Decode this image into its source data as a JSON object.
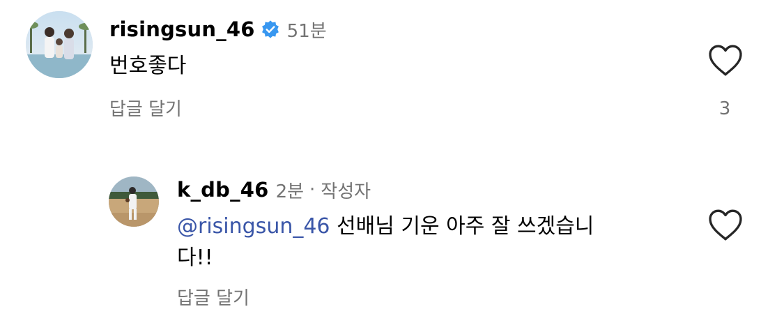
{
  "comments": [
    {
      "username": "risingsun_46",
      "verified": true,
      "time": "51분",
      "text": "번호좋다",
      "reply_label": "답글 달기",
      "like_count": "3"
    },
    {
      "username": "k_db_46",
      "verified": false,
      "time": "2분",
      "separator": "·",
      "author_badge": "작성자",
      "mention": "@risingsun_46",
      "text_line1": " 선배님 기운 아주 잘 쓰겠습니",
      "text_line2": "다!!",
      "reply_label": "답글 달기"
    }
  ],
  "icons": {
    "like": "heart-outline-icon",
    "verified": "verified-badge-icon"
  },
  "colors": {
    "verified_blue": "#3897f0",
    "secondary_text": "#737373",
    "mention": "#3a56a8"
  }
}
